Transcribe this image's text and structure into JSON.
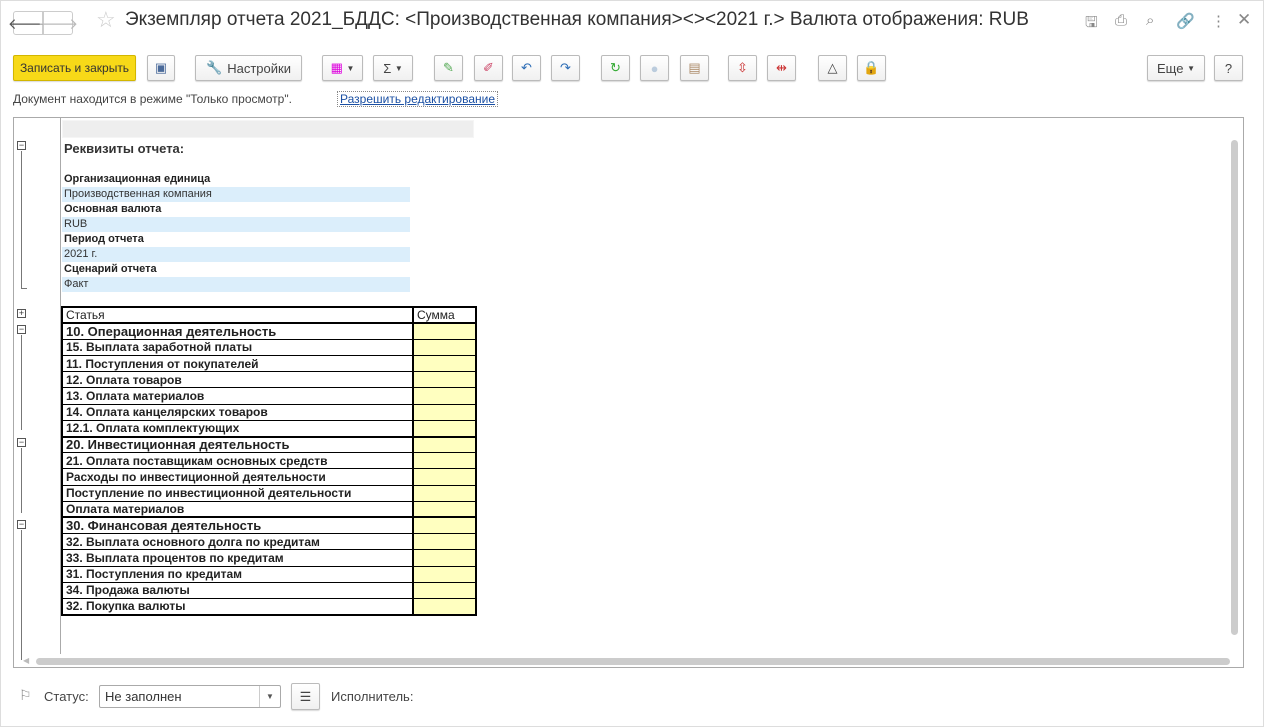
{
  "window": {
    "title": "Экземпляр отчета 2021_БДДС: <Производственная компания><><2021 г.> Валюта отображения: RUB"
  },
  "toolbar": {
    "save_close": "Записать и закрыть",
    "settings": "Настройки",
    "more": "Еще",
    "help": "?"
  },
  "mode": {
    "text": "Документ находится в режиме \"Только просмотр\".",
    "allow_edit": "Разрешить редактирование"
  },
  "report": {
    "requisites_title": "Реквизиты отчета:",
    "fields": [
      {
        "label": "Организационная единица",
        "value": "Производственная компания"
      },
      {
        "label": "Основная валюта",
        "value": "RUB"
      },
      {
        "label": "Период отчета",
        "value": "2021 г."
      },
      {
        "label": "Сценарий отчета",
        "value": "Факт"
      }
    ],
    "columns": [
      "Статья",
      "Сумма"
    ],
    "rows": [
      {
        "name": "10. Операционная деятельность",
        "group": true,
        "sum": ""
      },
      {
        "name": "15. Выплата заработной платы",
        "sum": ""
      },
      {
        "name": "11. Поступления от покупателей",
        "sum": ""
      },
      {
        "name": "12. Оплата товаров",
        "sum": ""
      },
      {
        "name": "13. Оплата материалов",
        "sum": ""
      },
      {
        "name": "14. Оплата канцелярских товаров",
        "sum": ""
      },
      {
        "name": "12.1. Оплата комплектующих",
        "sum": ""
      },
      {
        "name": "20. Инвестиционная деятельность",
        "group": true,
        "sum": ""
      },
      {
        "name": "21. Оплата поставщикам основных средств",
        "sum": ""
      },
      {
        "name": "Расходы по инвестиционной деятельности",
        "sum": ""
      },
      {
        "name": "Поступление по инвестиционной деятельности",
        "sum": ""
      },
      {
        "name": "Оплата материалов",
        "sum": ""
      },
      {
        "name": "30. Финансовая деятельность",
        "group": true,
        "sum": ""
      },
      {
        "name": "32. Выплата основного долга по кредитам",
        "sum": ""
      },
      {
        "name": "33. Выплата процентов по кредитам",
        "sum": ""
      },
      {
        "name": "31. Поступления по кредитам",
        "sum": ""
      },
      {
        "name": "34. Продажа валюты",
        "sum": ""
      },
      {
        "name": "32. Покупка валюты",
        "sum": ""
      }
    ]
  },
  "footer": {
    "status_label": "Статус:",
    "status_value": "Не заполнен",
    "executor_label": "Исполнитель:"
  }
}
